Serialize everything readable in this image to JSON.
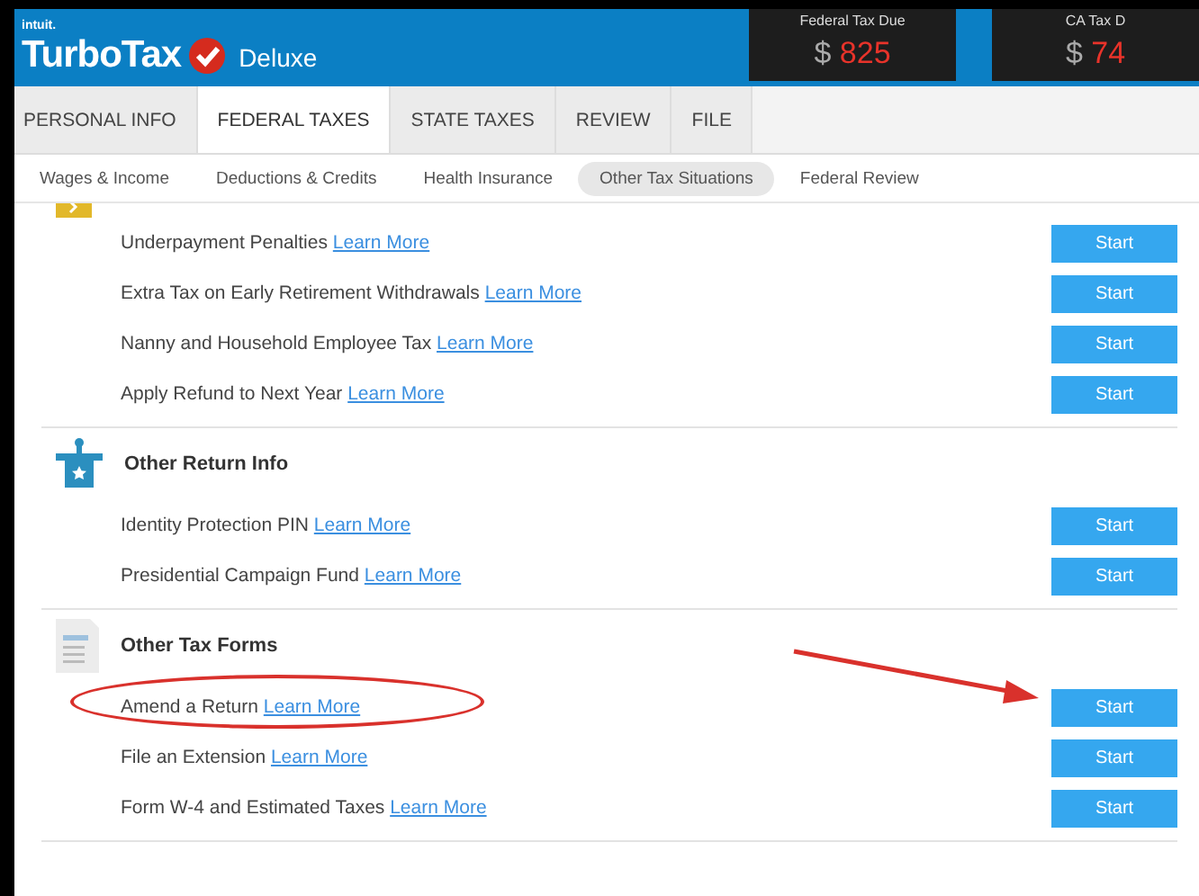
{
  "header": {
    "brand_prefix": "intuit.",
    "brand": "TurboTax",
    "edition": "Deluxe",
    "tax_due": [
      {
        "label": "Federal Tax Due",
        "currency": "$",
        "amount": "825"
      },
      {
        "label": "CA Tax D",
        "currency": "$",
        "amount": "74"
      }
    ]
  },
  "tabs": [
    {
      "label": "PERSONAL INFO",
      "selected": false
    },
    {
      "label": "FEDERAL TAXES",
      "selected": true
    },
    {
      "label": "STATE TAXES",
      "selected": false
    },
    {
      "label": "REVIEW",
      "selected": false
    },
    {
      "label": "FILE",
      "selected": false
    }
  ],
  "subtabs": [
    {
      "label": "Wages & Income",
      "selected": false
    },
    {
      "label": "Deductions & Credits",
      "selected": false
    },
    {
      "label": "Health Insurance",
      "selected": false
    },
    {
      "label": "Other Tax Situations",
      "selected": true
    },
    {
      "label": "Federal Review",
      "selected": false
    }
  ],
  "sections": [
    {
      "kind": "payments",
      "rows": [
        {
          "label": "Underpayment Penalties",
          "link": "Learn More",
          "button": "Start",
          "circled": false,
          "arrow": false
        },
        {
          "label": "Extra Tax on Early Retirement Withdrawals",
          "link": "Learn More",
          "button": "Start",
          "circled": false,
          "arrow": false
        },
        {
          "label": "Nanny and Household Employee Tax",
          "link": "Learn More",
          "button": "Start",
          "circled": false,
          "arrow": false
        },
        {
          "label": "Apply Refund to Next Year",
          "link": "Learn More",
          "button": "Start",
          "circled": false,
          "arrow": false
        }
      ]
    },
    {
      "kind": "return_info",
      "title": "Other Return Info",
      "rows": [
        {
          "label": "Identity Protection PIN",
          "link": "Learn More",
          "button": "Start",
          "circled": false,
          "arrow": false
        },
        {
          "label": "Presidential Campaign Fund",
          "link": "Learn More",
          "button": "Start",
          "circled": false,
          "arrow": false
        }
      ]
    },
    {
      "kind": "forms",
      "title": "Other Tax Forms",
      "rows": [
        {
          "label": "Amend a Return",
          "link": "Learn More",
          "button": "Start",
          "circled": true,
          "arrow": true
        },
        {
          "label": "File an Extension",
          "link": "Learn More",
          "button": "Start",
          "circled": false,
          "arrow": false
        },
        {
          "label": "Form W-4 and Estimated Taxes",
          "link": "Learn More",
          "button": "Start",
          "circled": false,
          "arrow": false
        }
      ]
    }
  ]
}
